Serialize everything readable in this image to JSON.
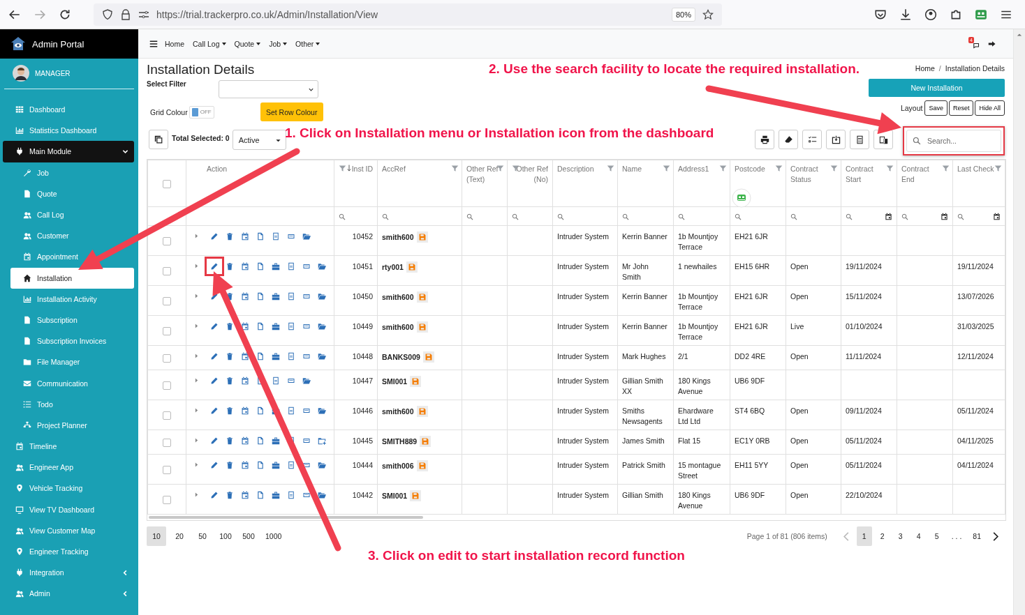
{
  "browser": {
    "url": "https://trial.trackerpro.co.uk/Admin/Installation/View",
    "zoom": "80%"
  },
  "sidebar": {
    "brand": "Admin Portal",
    "user": "MANAGER",
    "items": [
      {
        "label": "Dashboard",
        "selected": false
      },
      {
        "label": "Statistics Dashboard",
        "selected": false
      },
      {
        "label": "Main Module",
        "selected": false,
        "expanded": true,
        "children": [
          {
            "label": "Job",
            "selected": false
          },
          {
            "label": "Quote",
            "selected": false
          },
          {
            "label": "Call Log",
            "selected": false
          },
          {
            "label": "Customer",
            "selected": false
          },
          {
            "label": "Appointment",
            "selected": false
          },
          {
            "label": "Installation",
            "selected": true
          },
          {
            "label": "Installation Activity",
            "selected": false
          },
          {
            "label": "Subscription",
            "selected": false
          },
          {
            "label": "Subscription Invoices",
            "selected": false
          },
          {
            "label": "File Manager",
            "selected": false
          },
          {
            "label": "Communication",
            "selected": false
          },
          {
            "label": "Todo",
            "selected": false
          },
          {
            "label": "Project Planner",
            "selected": false
          }
        ]
      },
      {
        "label": "Timeline",
        "selected": false
      },
      {
        "label": "Engineer App",
        "selected": false
      },
      {
        "label": "Vehicle Tracking",
        "selected": false
      },
      {
        "label": "View TV Dashboard",
        "selected": false
      },
      {
        "label": "View Customer Map",
        "selected": false
      },
      {
        "label": "Engineer Tracking",
        "selected": false
      },
      {
        "label": "Integration",
        "selected": false,
        "expanded": false
      },
      {
        "label": "Admin",
        "selected": false,
        "expanded": false
      }
    ]
  },
  "topnav": {
    "items": [
      {
        "label": "Home",
        "dropdown": false
      },
      {
        "label": "Call Log",
        "dropdown": true
      },
      {
        "label": "Quote",
        "dropdown": true
      },
      {
        "label": "Job",
        "dropdown": true
      },
      {
        "label": "Other",
        "dropdown": true
      }
    ],
    "notifications": "4"
  },
  "page": {
    "title": "Installation Details",
    "breadcrumb": [
      "Home",
      "Installation Details"
    ],
    "breadcrumb_separator": "/",
    "filter_label": "Select Filter",
    "grid_colour": {
      "label": "Grid Colour",
      "on": false,
      "state_text": "OFF"
    },
    "set_row_colour": "Set Row Colour",
    "new_button": "New Installation",
    "layout": {
      "label": "Layout",
      "buttons": [
        "Save",
        "Reset",
        "Hide All"
      ]
    },
    "total_selected": "Total Selected: 0",
    "status_filter": "Active",
    "search": {
      "placeholder": "Search...",
      "highlighted": true
    }
  },
  "table": {
    "all_selected": false,
    "columns": [
      {
        "label": "Action",
        "kind": "action",
        "sorted": false
      },
      {
        "label": "Inst ID",
        "kind": "number",
        "sorted": true
      },
      {
        "label": "AccRef",
        "kind": "text",
        "sorted": false
      },
      {
        "label": "Other Ref (Text)",
        "kind": "text",
        "sorted": false
      },
      {
        "label": "Other Ref (No)",
        "kind": "number",
        "sorted": false
      },
      {
        "label": "Description",
        "kind": "text",
        "sorted": false
      },
      {
        "label": "Name",
        "kind": "text",
        "sorted": false
      },
      {
        "label": "Address1",
        "kind": "text",
        "sorted": false
      },
      {
        "label": "Postcode",
        "kind": "text",
        "sorted": false
      },
      {
        "label": "Contract Status",
        "kind": "text",
        "sorted": false
      },
      {
        "label": "Contract Start",
        "kind": "date",
        "sorted": false
      },
      {
        "label": "Contract End",
        "kind": "date",
        "sorted": false
      },
      {
        "label": "Last Check",
        "kind": "date",
        "sorted": false
      }
    ],
    "rows": [
      {
        "selected": false,
        "marked": false,
        "actions": [
          {
            "kind": "edit"
          },
          {
            "kind": "delete"
          },
          {
            "kind": "calendar"
          },
          {
            "kind": "file"
          },
          {
            "kind": "pdf"
          },
          {
            "kind": "docx"
          },
          {
            "kind": "folder"
          }
        ],
        "inst_id": "10452",
        "accref": "smith600",
        "description": "Intruder System",
        "name": "Kerrin Banner",
        "address": "1b Mountjoy Terrace",
        "postcode": "EH21 6JR"
      },
      {
        "selected": false,
        "marked": true,
        "actions": [
          {
            "kind": "edit"
          },
          {
            "kind": "delete"
          },
          {
            "kind": "calendar"
          },
          {
            "kind": "file"
          },
          {
            "kind": "toolbox"
          },
          {
            "kind": "pdf"
          },
          {
            "kind": "docx"
          },
          {
            "kind": "folder"
          }
        ],
        "inst_id": "10451",
        "accref": "rty001",
        "description": "Intruder System",
        "name": "Mr John Smith",
        "address": "1 newhailes",
        "postcode": "EH15 6HR",
        "status": "Open",
        "start": "19/11/2024",
        "last_check": "19/11/2024"
      },
      {
        "selected": false,
        "marked": false,
        "actions": [
          {
            "kind": "edit"
          },
          {
            "kind": "delete"
          },
          {
            "kind": "calendar"
          },
          {
            "kind": "file"
          },
          {
            "kind": "toolbox"
          },
          {
            "kind": "pdf"
          },
          {
            "kind": "docx"
          },
          {
            "kind": "folder"
          }
        ],
        "inst_id": "10450",
        "accref": "smith600",
        "description": "Intruder System",
        "name": "Kerrin Banner",
        "address": "1b Mountjoy Terrace",
        "postcode": "EH21 6JR",
        "status": "Open",
        "start": "15/11/2024",
        "last_check": "13/07/2026"
      },
      {
        "selected": false,
        "marked": false,
        "actions": [
          {
            "kind": "edit"
          },
          {
            "kind": "delete"
          },
          {
            "kind": "calendar"
          },
          {
            "kind": "file"
          },
          {
            "kind": "toolbox"
          },
          {
            "kind": "pdf"
          },
          {
            "kind": "docx"
          },
          {
            "kind": "folder"
          }
        ],
        "inst_id": "10449",
        "accref": "smith600",
        "description": "Intruder System",
        "name": "Kerrin Banner",
        "address": "1b Mountjoy Terrace",
        "postcode": "EH21 6JR",
        "status": "Live",
        "start": "01/10/2024",
        "last_check": "31/03/2025"
      },
      {
        "selected": false,
        "marked": false,
        "actions": [
          {
            "kind": "edit"
          },
          {
            "kind": "delete"
          },
          {
            "kind": "calendar"
          },
          {
            "kind": "file"
          },
          {
            "kind": "toolbox"
          },
          {
            "kind": "pdf"
          },
          {
            "kind": "docx"
          },
          {
            "kind": "folder"
          }
        ],
        "inst_id": "10448",
        "accref": "BANKS009",
        "description": "Intruder System",
        "name": "Mark Hughes",
        "address": "2/1",
        "postcode": "DD2 4RE",
        "status": "Open",
        "start": "11/11/2024",
        "last_check": "12/11/2024"
      },
      {
        "selected": false,
        "marked": false,
        "actions": [
          {
            "kind": "edit"
          },
          {
            "kind": "delete"
          },
          {
            "kind": "calendar"
          },
          {
            "kind": "file"
          },
          {
            "kind": "pdf"
          },
          {
            "kind": "docx"
          },
          {
            "kind": "folder"
          }
        ],
        "inst_id": "10447",
        "accref": "SMI001",
        "description": "Intruder System",
        "name": "Gillian Smith XX",
        "address": "180 Kings Avenue",
        "postcode": "UB6 9DF"
      },
      {
        "selected": false,
        "marked": false,
        "actions": [
          {
            "kind": "edit"
          },
          {
            "kind": "delete"
          },
          {
            "kind": "calendar"
          },
          {
            "kind": "file"
          },
          {
            "kind": "toolbox"
          },
          {
            "kind": "pdf"
          },
          {
            "kind": "docx"
          },
          {
            "kind": "folder"
          }
        ],
        "inst_id": "10446",
        "accref": "smith600",
        "description": "Intruder System",
        "name": "Smiths Newsagents",
        "address": "Ehardware Ltd Ltd",
        "postcode": "ST4 6BQ",
        "status": "Open",
        "start": "09/11/2024",
        "last_check": "05/11/2024"
      },
      {
        "selected": false,
        "marked": false,
        "actions": [
          {
            "kind": "edit"
          },
          {
            "kind": "delete"
          },
          {
            "kind": "calendar"
          },
          {
            "kind": "file"
          },
          {
            "kind": "toolbox"
          },
          {
            "kind": "pdf"
          },
          {
            "kind": "docx"
          },
          {
            "kind": "folder-plus"
          }
        ],
        "inst_id": "10445",
        "accref": "SMITH889",
        "description": "Intruder System",
        "name": "James Smith",
        "address": "Flat 15",
        "postcode": "EC1Y 0RB",
        "status": "Open",
        "start": "05/11/2024",
        "last_check": "04/11/2025"
      },
      {
        "selected": false,
        "marked": false,
        "actions": [
          {
            "kind": "edit"
          },
          {
            "kind": "delete"
          },
          {
            "kind": "calendar"
          },
          {
            "kind": "file"
          },
          {
            "kind": "toolbox"
          },
          {
            "kind": "pdf"
          },
          {
            "kind": "docx"
          },
          {
            "kind": "folder"
          }
        ],
        "inst_id": "10444",
        "accref": "smith006",
        "description": "Intruder System",
        "name": "Patrick Smith",
        "address": "15 montague Street",
        "postcode": "EH11 5YY",
        "status": "Open",
        "start": "05/11/2024",
        "last_check": "04/11/2024"
      },
      {
        "selected": false,
        "marked": false,
        "actions": [
          {
            "kind": "edit"
          },
          {
            "kind": "delete"
          },
          {
            "kind": "calendar"
          },
          {
            "kind": "file"
          },
          {
            "kind": "toolbox"
          },
          {
            "kind": "pdf"
          },
          {
            "kind": "docx"
          },
          {
            "kind": "folder"
          }
        ],
        "inst_id": "10442",
        "accref": "SMI001",
        "description": "Intruder System",
        "name": "Gillian Smith",
        "address": "180 Kings Avenue",
        "postcode": "UB6 9DF",
        "status": "Open",
        "start": "22/10/2024"
      }
    ]
  },
  "pagination": {
    "sizes": [
      {
        "label": "10",
        "selected": true
      },
      {
        "label": "20",
        "selected": false
      },
      {
        "label": "50",
        "selected": false
      },
      {
        "label": "100",
        "selected": false
      },
      {
        "label": "500",
        "selected": false
      },
      {
        "label": "1000",
        "selected": false
      }
    ],
    "info": "Page 1 of 81 (806 items)",
    "previous_disabled": true,
    "next_disabled": false,
    "pages": [
      {
        "label": "1",
        "selected": true
      },
      {
        "label": "2",
        "selected": false
      },
      {
        "label": "3",
        "selected": false
      },
      {
        "label": "4",
        "selected": false
      },
      {
        "label": "5",
        "selected": false
      },
      {
        "label": ". . .",
        "selected": false
      },
      {
        "label": "81",
        "selected": false
      }
    ]
  },
  "annotations": [
    "1. Click on Installation menu or Installation icon from the dashboard",
    "2. Use the search facility to locate the required installation.",
    "3. Click on edit to start installation record function"
  ]
}
